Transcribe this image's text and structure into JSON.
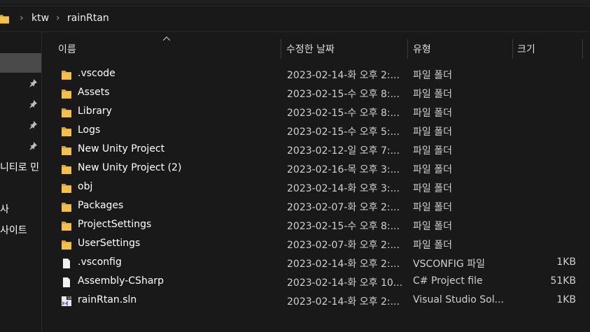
{
  "breadcrumb": {
    "segments": [
      "ktw",
      "rainRtan"
    ],
    "separator": "›"
  },
  "nav": {
    "partial_items": [
      "니티로 민",
      "사",
      "사이트"
    ]
  },
  "columns": {
    "name": "이름",
    "date": "수정한 날짜",
    "type": "유형",
    "size": "크기"
  },
  "files": [
    {
      "name": ".vscode",
      "date": "2023-02-14-화 오후 2:...",
      "type": "파일 폴더",
      "size": "",
      "icon": "folder-icon"
    },
    {
      "name": "Assets",
      "date": "2023-02-15-수 오후 8:...",
      "type": "파일 폴더",
      "size": "",
      "icon": "folder-icon"
    },
    {
      "name": "Library",
      "date": "2023-02-15-수 오후 8:...",
      "type": "파일 폴더",
      "size": "",
      "icon": "folder-icon"
    },
    {
      "name": "Logs",
      "date": "2023-02-15-수 오후 5:...",
      "type": "파일 폴더",
      "size": "",
      "icon": "folder-icon"
    },
    {
      "name": "New Unity Project",
      "date": "2023-02-12-일 오후 7:...",
      "type": "파일 폴더",
      "size": "",
      "icon": "folder-icon"
    },
    {
      "name": "New Unity Project (2)",
      "date": "2023-02-16-목 오후 3:...",
      "type": "파일 폴더",
      "size": "",
      "icon": "folder-icon"
    },
    {
      "name": "obj",
      "date": "2023-02-14-화 오후 3:...",
      "type": "파일 폴더",
      "size": "",
      "icon": "folder-icon"
    },
    {
      "name": "Packages",
      "date": "2023-02-07-화 오후 2:...",
      "type": "파일 폴더",
      "size": "",
      "icon": "folder-icon"
    },
    {
      "name": "ProjectSettings",
      "date": "2023-02-15-수 오후 8:...",
      "type": "파일 폴더",
      "size": "",
      "icon": "folder-icon"
    },
    {
      "name": "UserSettings",
      "date": "2023-02-07-화 오후 2:...",
      "type": "파일 폴더",
      "size": "",
      "icon": "folder-icon"
    },
    {
      "name": ".vsconfig",
      "date": "2023-02-14-화 오후 2:...",
      "type": "VSCONFIG 파일",
      "size": "1KB",
      "icon": "file-icon"
    },
    {
      "name": "Assembly-CSharp",
      "date": "2023-02-14-화 오후 10...",
      "type": "C# Project file",
      "size": "51KB",
      "icon": "file-icon"
    },
    {
      "name": "rainRtan.sln",
      "date": "2023-02-14-화 오후 2:...",
      "type": "Visual Studio Sol...",
      "size": "1KB",
      "icon": "visual-studio-solution-icon"
    }
  ],
  "colors": {
    "background": "#191919",
    "folder": "#f3c04a",
    "selection": "#4a4a4a"
  }
}
